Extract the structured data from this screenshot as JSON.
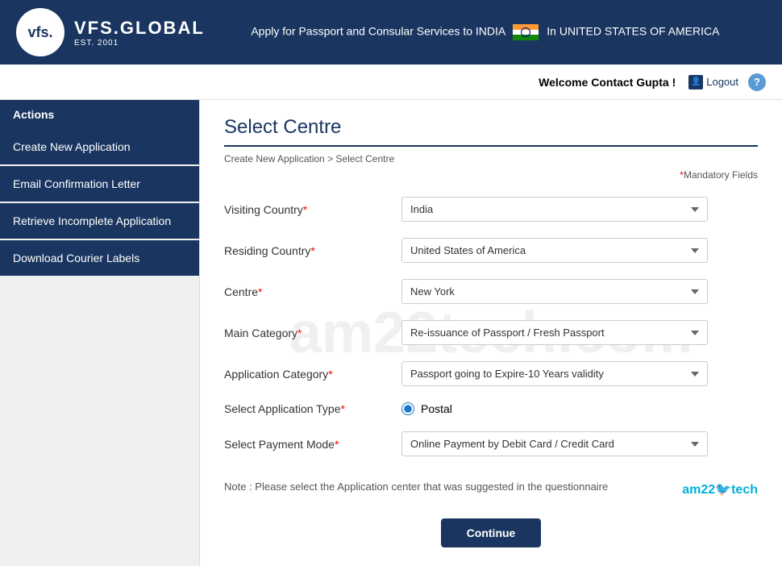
{
  "header": {
    "logo_text": "vfs.",
    "logo_sub": "VFS.GLOBAL",
    "logo_est": "EST. 2001",
    "tagline": "Apply for Passport and Consular Services to INDIA",
    "country": "In UNITED STATES OF AMERICA"
  },
  "topbar": {
    "welcome": "Welcome Contact Gupta !",
    "logout": "Logout",
    "help": "?"
  },
  "sidebar": {
    "header": "Actions",
    "items": [
      {
        "label": "Create New Application"
      },
      {
        "label": "Email Confirmation Letter"
      },
      {
        "label": "Retrieve Incomplete Application"
      },
      {
        "label": "Download Courier Labels"
      }
    ]
  },
  "page": {
    "title": "Select Centre",
    "breadcrumb_part1": "Create New Application",
    "breadcrumb_sep": " > ",
    "breadcrumb_part2": "Select Centre",
    "mandatory_label": "*Mandatory Fields"
  },
  "form": {
    "visiting_country_label": "Visiting Country",
    "visiting_country_value": "India",
    "residing_country_label": "Residing Country",
    "residing_country_value": "United States of America",
    "centre_label": "Centre",
    "centre_value": "New York",
    "main_category_label": "Main Category",
    "main_category_value": "Re-issuance of Passport / Fresh Passport",
    "app_category_label": "Application Category",
    "app_category_value": "Passport going to Expire-10 Years validity",
    "app_type_label": "Select Application Type",
    "app_type_value": "Postal",
    "payment_mode_label": "Select Payment Mode",
    "payment_mode_value": "Online Payment by Debit Card / Credit Card",
    "note": "Note : Please select the Application center that was suggested in the questionnaire",
    "am22_brand": "am22",
    "am22_suffix": "tech",
    "continue_btn": "Continue"
  },
  "watermark": "am22tech.com"
}
